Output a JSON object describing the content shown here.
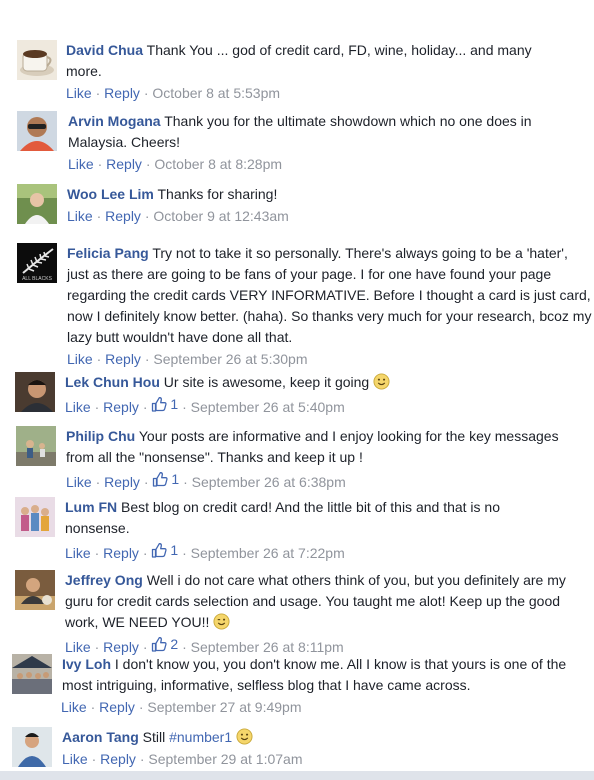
{
  "labels": {
    "like": "Like",
    "reply": "Reply",
    "sep": "·"
  },
  "colors": {
    "author": "#365899",
    "link": "#4267b2",
    "meta": "#90949c"
  },
  "comments": [
    {
      "author": "David Chua",
      "text": "Thank You ... god of credit card, FD, wine, holiday... and many more.",
      "time": "October 8 at 5:53pm",
      "likes": "",
      "avatar_icon": "coffee-cup"
    },
    {
      "author": "Arvin Mogana",
      "text": "Thank you for the ultimate showdown which no one does in Malaysia. Cheers!",
      "time": "October 8 at 8:28pm",
      "likes": "",
      "avatar_icon": "man-sunglasses"
    },
    {
      "author": "Woo Lee Lim",
      "text": "Thanks for sharing!",
      "time": "October 9 at 12:43am",
      "likes": "",
      "avatar_icon": "woman-outdoors"
    },
    {
      "author": "Felicia Pang",
      "text": "Try not to take it so personally. There's always going to be a 'hater', just as there are going to be fans of your page. I for one have found your page regarding the credit cards VERY INFORMATIVE. Before I thought a card is just card, now I definitely know better. (haha). So thanks very much for your research, bcoz my lazy butt wouldn't have done all that.",
      "time": "September 26 at 5:30pm",
      "likes": "",
      "avatar_icon": "fern-logo",
      "avatar_caption": "ALL BLACKS"
    },
    {
      "author": "Lek Chun Hou",
      "text": "Ur site is awesome, keep it going",
      "time": "September 26 at 5:40pm",
      "likes": "1",
      "avatar_icon": "man-portrait",
      "emoji": "smiley"
    },
    {
      "author": "Philip Chu",
      "text": "Your posts are informative and I enjoy looking for the key messages from all the \"nonsense\". Thanks and keep it up !",
      "time": "September 26 at 6:38pm",
      "likes": "1",
      "avatar_icon": "family-park"
    },
    {
      "author": "Lum FN",
      "text": "Best blog on credit card! And the little bit of this and that is no nonsense.",
      "time": "September 26 at 7:22pm",
      "likes": "1",
      "avatar_icon": "group-photo"
    },
    {
      "author": "Jeffrey Ong",
      "text": "Well i do not care what others think of you, but you definitely are my guru for credit cards selection and usage. You taught me alot! Keep up the good work, WE NEED YOU!!",
      "time": "September 26 at 8:11pm",
      "likes": "2",
      "avatar_icon": "man-dining",
      "emoji": "wink"
    },
    {
      "author": "Ivy Loh",
      "text": "I don't know you, you don't know me. All I know is that yours is one of the most intriguing, informative, selfless blog that I have came across.",
      "time": "September 27 at 9:49pm",
      "likes": "",
      "avatar_icon": "crowd-tent"
    },
    {
      "author": "Aaron Tang",
      "text": "Still",
      "hashtag": "#number1",
      "time": "September 29 at 1:07am",
      "likes": "",
      "avatar_icon": "man-blue-shirt",
      "emoji": "smiley"
    }
  ]
}
